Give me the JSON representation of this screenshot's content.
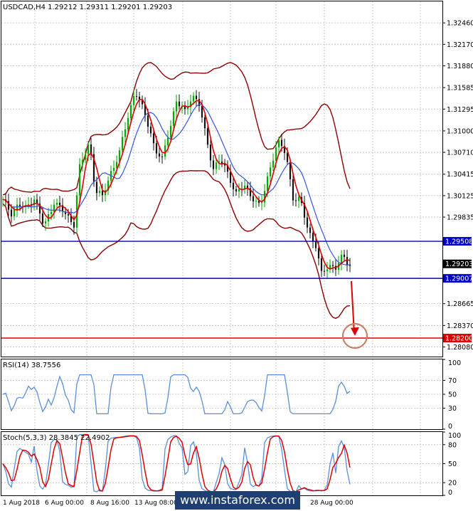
{
  "chart_data": [
    {
      "type": "line",
      "panel": "price",
      "title": "USDCAD,H4  1.29212  1.29311  1.29201  1.29203",
      "y_ticks": [
        "1.32460",
        "1.32170",
        "1.31880",
        "1.31585",
        "1.31295",
        "1.31000",
        "1.30710",
        "1.30415",
        "1.30125",
        "1.29835",
        "1.29508",
        "1.29203",
        "1.29007",
        "1.28665",
        "1.28370",
        "1.28200",
        "1.28080"
      ],
      "ylim": [
        1.2795,
        1.3275
      ],
      "plain_ticks": [
        1.3246,
        1.3217,
        1.3188,
        1.31585,
        1.31295,
        1.31,
        1.3071,
        1.30415,
        1.30125,
        1.29835,
        1.28665,
        1.2837,
        1.2808
      ],
      "levels": [
        {
          "label": "1.29508",
          "value": 1.29508,
          "color": "#0000cc"
        },
        {
          "label": "1.29007",
          "value": 1.29007,
          "color": "#0000cc"
        },
        {
          "label": "1.28200",
          "value": 1.282,
          "color": "#dd0000"
        }
      ],
      "current_price": {
        "label": "1.29203",
        "value": 1.29203
      },
      "x_ticks": [
        "1 Aug 2018",
        "6 Aug 00:00",
        "8 Aug 16:00",
        "13 Aug 08:00",
        "",
        "",
        "",
        "28 Aug 00:00"
      ],
      "colors": {
        "bull": "#00aa00",
        "bear": "#111111",
        "ma_fast": "#dd0000",
        "ma_slow": "#3355dd",
        "bands": "#8b0000",
        "arrow": "#dd0000",
        "target_circle": "#c8826a"
      }
    },
    {
      "type": "line",
      "panel": "rsi",
      "title": "RSI(14) 38.7556",
      "y_ticks": [
        "100",
        "70",
        "50",
        "30",
        "0"
      ],
      "ylim": [
        0,
        100
      ],
      "levels": [
        70,
        50,
        30
      ],
      "colors": {
        "line": "#5a8fd8"
      }
    },
    {
      "type": "line",
      "panel": "stochastic",
      "title": "Stoch(5,3,3) 28.3845 22.4902",
      "y_ticks": [
        "100",
        "80",
        "50",
        "20",
        "0"
      ],
      "ylim": [
        0,
        100
      ],
      "levels": [
        80,
        50,
        20
      ],
      "colors": {
        "main": "#5a8fd8",
        "signal": "#dd0000"
      }
    }
  ],
  "watermark": "www.instaforex.com"
}
